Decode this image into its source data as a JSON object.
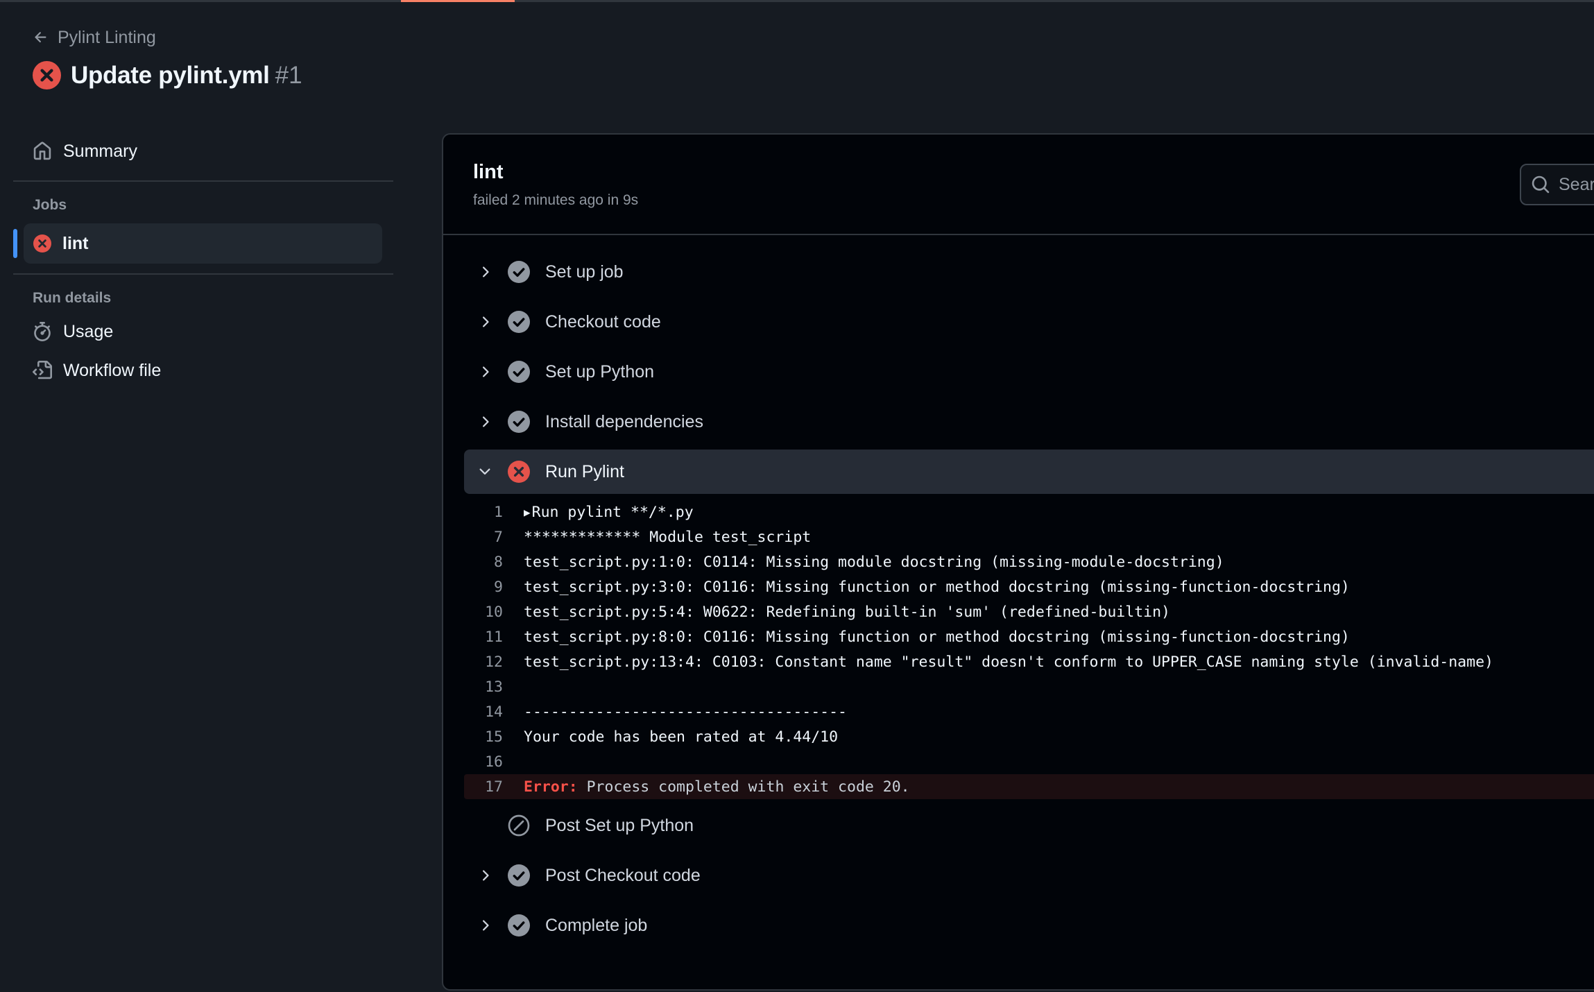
{
  "header": {
    "back_label": "Pylint Linting",
    "title": "Update pylint.yml",
    "run_number": "#1"
  },
  "sidebar": {
    "summary_label": "Summary",
    "jobs_heading": "Jobs",
    "job_label": "lint",
    "run_details_heading": "Run details",
    "usage_label": "Usage",
    "workflow_file_label": "Workflow file"
  },
  "panel": {
    "job_name": "lint",
    "job_status": "failed 2 minutes ago in 9s",
    "search_placeholder": "Search logs"
  },
  "steps": [
    {
      "label": "Set up job",
      "status": "success"
    },
    {
      "label": "Checkout code",
      "status": "success"
    },
    {
      "label": "Set up Python",
      "status": "success"
    },
    {
      "label": "Install dependencies",
      "status": "success"
    },
    {
      "label": "Run Pylint",
      "status": "failure",
      "expanded": true
    },
    {
      "label": "Post Set up Python",
      "status": "skipped"
    },
    {
      "label": "Post Checkout code",
      "status": "success"
    },
    {
      "label": "Complete job",
      "status": "success"
    }
  ],
  "log": [
    {
      "n": "1",
      "text": "Run pylint **/*.py",
      "collapsible": true
    },
    {
      "n": "7",
      "text": "************* Module test_script"
    },
    {
      "n": "8",
      "text": "test_script.py:1:0: C0114: Missing module docstring (missing-module-docstring)"
    },
    {
      "n": "9",
      "text": "test_script.py:3:0: C0116: Missing function or method docstring (missing-function-docstring)"
    },
    {
      "n": "10",
      "text": "test_script.py:5:4: W0622: Redefining built-in 'sum' (redefined-builtin)"
    },
    {
      "n": "11",
      "text": "test_script.py:8:0: C0116: Missing function or method docstring (missing-function-docstring)"
    },
    {
      "n": "12",
      "text": "test_script.py:13:4: C0103: Constant name \"result\" doesn't conform to UPPER_CASE naming style (invalid-name)"
    },
    {
      "n": "13",
      "text": ""
    },
    {
      "n": "14",
      "text": "------------------------------------"
    },
    {
      "n": "15",
      "text": "Your code has been rated at 4.44/10"
    },
    {
      "n": "16",
      "text": ""
    },
    {
      "n": "17",
      "error_label": "Error:",
      "text": " Process completed with exit code 20."
    }
  ],
  "colors": {
    "background": "#161b22",
    "panel": "#010409",
    "failure": "#e5534b",
    "success": "#9198a1",
    "accent": "#4493f8"
  }
}
